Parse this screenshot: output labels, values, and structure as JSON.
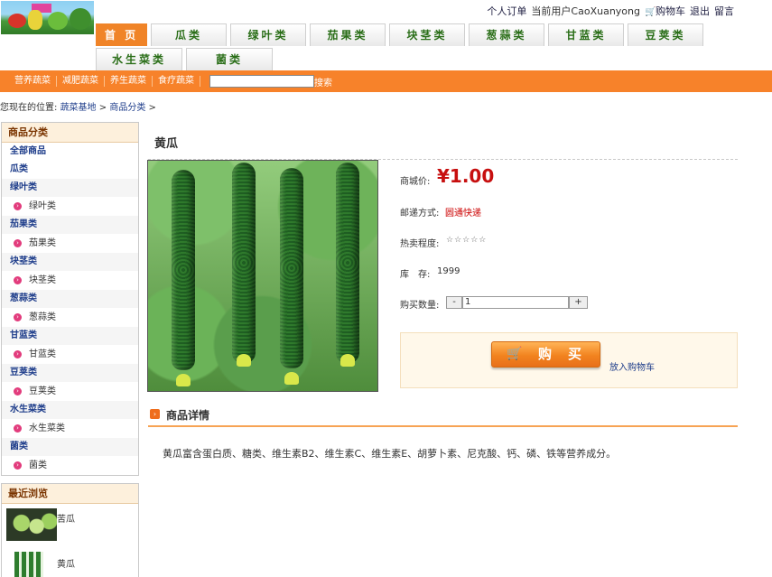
{
  "header": {
    "links": [
      {
        "label": "个人订单"
      },
      {
        "label": "当前用户CaoXuanyong"
      },
      {
        "label": "购物车",
        "icon": "cart-icon"
      },
      {
        "label": "退出"
      },
      {
        "label": "留言"
      }
    ]
  },
  "nav": {
    "tabs_row1": [
      "首 页",
      "瓜类",
      "绿叶类",
      "茄果类",
      "块茎类",
      "葱蒜类",
      "甘蓝类",
      "豆荚类"
    ],
    "tabs_row2": [
      "水生菜类",
      "菌类"
    ],
    "active_index": 0
  },
  "subnav": {
    "links": [
      "营养蔬菜",
      "减肥蔬菜",
      "养生蔬菜",
      "食疗蔬菜"
    ],
    "search_value": "",
    "search_button": "搜索"
  },
  "breadcrumb": {
    "prefix": "您现在的位置:",
    "items": [
      "蔬菜基地",
      "商品分类"
    ],
    "separator": ">"
  },
  "sidebar": {
    "category_title": "商品分类",
    "categories": [
      {
        "main": "全部商品",
        "sub": null
      },
      {
        "main": "瓜类",
        "sub": null
      },
      {
        "main": "绿叶类",
        "sub": "绿叶类"
      },
      {
        "main": "茄果类",
        "sub": "茄果类"
      },
      {
        "main": "块茎类",
        "sub": "块茎类"
      },
      {
        "main": "葱蒜类",
        "sub": "葱蒜类"
      },
      {
        "main": "甘蓝类",
        "sub": "甘蓝类"
      },
      {
        "main": "豆荚类",
        "sub": "豆荚类"
      },
      {
        "main": "水生菜类",
        "sub": "水生菜类"
      },
      {
        "main": "菌类",
        "sub": "菌类"
      }
    ],
    "recent_title": "最近浏览",
    "recent": [
      {
        "name": "苦瓜"
      },
      {
        "name": "黄瓜"
      }
    ]
  },
  "product": {
    "name": "黄瓜",
    "price_label": "商城价:",
    "price": "¥1.00",
    "shipping_label": "邮递方式:",
    "shipping_value": "圆通快递",
    "popularity_label": "热卖程度:",
    "popularity_stars": "☆☆☆☆☆",
    "stock_label": "库　存:",
    "stock_value": "1999",
    "quantity_label": "购买数量:",
    "quantity_value": "1",
    "minus_label": "-",
    "plus_label": "+",
    "buy_label": "购买",
    "add_to_cart_label": "放入购物车",
    "details_title": "商品详情",
    "details_text": "黄瓜富含蛋白质、糖类、维生素B2、维生素C、维生素E、胡萝卜素、尼克酸、钙、磷、铁等营养成分。"
  },
  "colors": {
    "accent": "#f7822a",
    "price": "#c70f0f",
    "nav_text": "#2a6e18",
    "link": "#1d3c8a"
  }
}
